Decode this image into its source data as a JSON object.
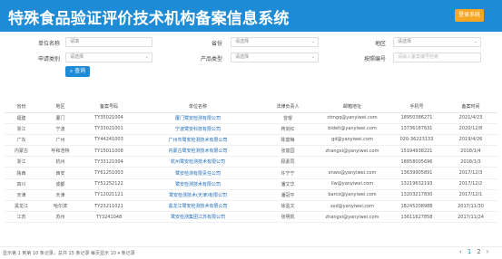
{
  "header": {
    "title": "特殊食品验证评价技术机构备案信息系统",
    "login": "登录系统"
  },
  "filters": {
    "org_name": {
      "label": "单位名称",
      "value": "请填"
    },
    "province": {
      "label": "省份",
      "value": "请选择"
    },
    "city": {
      "label": "地区",
      "value": "请选择"
    },
    "agency_type": {
      "label": "申请类别",
      "value": "请选择"
    },
    "product_type": {
      "label": "产品类型",
      "value": "请选择"
    },
    "record_no": {
      "label": "按照编号",
      "placeholder": "请输入备案编号检索"
    },
    "search_label": "查询"
  },
  "table": {
    "columns": [
      "省份",
      "地区",
      "备案号码",
      "单位名称",
      "法律负责人",
      "邮箱地址",
      "手机号",
      "备案时间"
    ],
    "rows": [
      [
        "福建",
        "厦门",
        "TY35021004",
        "厦门鹭安检测有限公司",
        "曾琨",
        "ctmgq@yanyiwei.com",
        "18950386271",
        "2021/4/23"
      ],
      [
        "浙江",
        "宁波",
        "TY33021001",
        "宁波鹭安科技有限公司",
        "蒋剑红",
        "bidelt@yanyiwei.com",
        "13736187631",
        "2020/12/8"
      ],
      [
        "广东",
        "广州",
        "TY44241003",
        "广州市鹭安检测技术有限公司",
        "陈富梅",
        "gd@yanyiwei.com",
        "020-36223133",
        "2019/4/26"
      ],
      [
        "内蒙古",
        "呼和浩特",
        "TY15011008",
        "内蒙古鹭安检测技术有限公司",
        "张富园",
        "zhangxi@yanyiwei.com",
        "15194938221",
        "2018/1/4"
      ],
      [
        "浙江",
        "杭州",
        "TY33121004",
        "杭州鹭安检测技术有限公司",
        "顾素同",
        "",
        "18858005696",
        "2018/1/3"
      ],
      [
        "陕西",
        "西安",
        "TY61251003",
        "鹭安检测有限责任公司",
        "许宁宁",
        "xnwo@yanyiwei.com",
        "13639905891",
        "2017/12/3"
      ],
      [
        "四川",
        "成都",
        "TY51252122",
        "鹭安检测技术有限公司",
        "潘文华",
        "ilw@yanyiwei.com",
        "13219632193",
        "2017/12/2"
      ],
      [
        "天津",
        "天津",
        "TY12021121",
        "鹭安检测技术(天津)有限公司",
        "潘冠平",
        "barco@yanyiwei.com",
        "13203217830",
        "2017/12/1"
      ],
      [
        "黑龙江",
        "哈尔滨",
        "TY23211021",
        "黑龙江鹭安检测技术有限公司",
        "徐盈文",
        "sxd@yanyiwei.com",
        "18245208988",
        "2017/11/30"
      ],
      [
        "江苏",
        "苏州",
        "TY3241048",
        "鹭安检测集团江苏有限公司",
        "张明凯",
        "zhangxi@yanyiwei.com",
        "13611627858",
        "2017/11/24"
      ]
    ]
  },
  "pager": {
    "info": "显示第 1 到第 10 条记录，总共 15 条记录 每页显示 10 ▾ 条记录",
    "pages": [
      "‹",
      "1",
      "2",
      "›"
    ]
  }
}
